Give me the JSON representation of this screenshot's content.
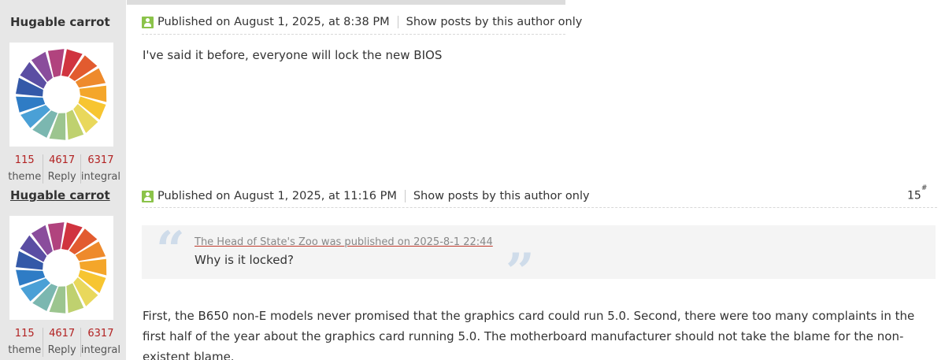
{
  "posts": [
    {
      "author": "Hugable carrot",
      "stats": [
        {
          "value": "115",
          "label": "theme"
        },
        {
          "value": "4617",
          "label": "Reply"
        },
        {
          "value": "6317",
          "label": "integral"
        }
      ],
      "published": "Published on August 1, 2025, at 8:38 PM",
      "author_only_label": "Show posts by this author only",
      "content": "I've said it before, everyone will lock the new BIOS"
    },
    {
      "author": "Hugable carrot",
      "stats": [
        {
          "value": "115",
          "label": "theme"
        },
        {
          "value": "4617",
          "label": "Reply"
        },
        {
          "value": "6317",
          "label": "integral"
        }
      ],
      "published": "Published on August 1, 2025, at 11:16 PM",
      "author_only_label": "Show posts by this author only",
      "floor_number": "15",
      "floor_symbol": "#",
      "quote": {
        "source": "The Head of State's Zoo was published on 2025-8-1 22:44",
        "text": "Why is it locked?"
      },
      "content": "First, the B650 non-E models never promised that the graphics card could run 5.0. Second, there were too many complaints in the first half of the year about the graphics card running 5.0. The motherboard manufacturer should not take the blame for the non-existent blame."
    }
  ],
  "colors": {
    "stat_value": "#b22222",
    "user_icon": "#8bc34a",
    "quote_bg": "#f4f4f4",
    "sidebar_bg": "#e7e7e7"
  }
}
